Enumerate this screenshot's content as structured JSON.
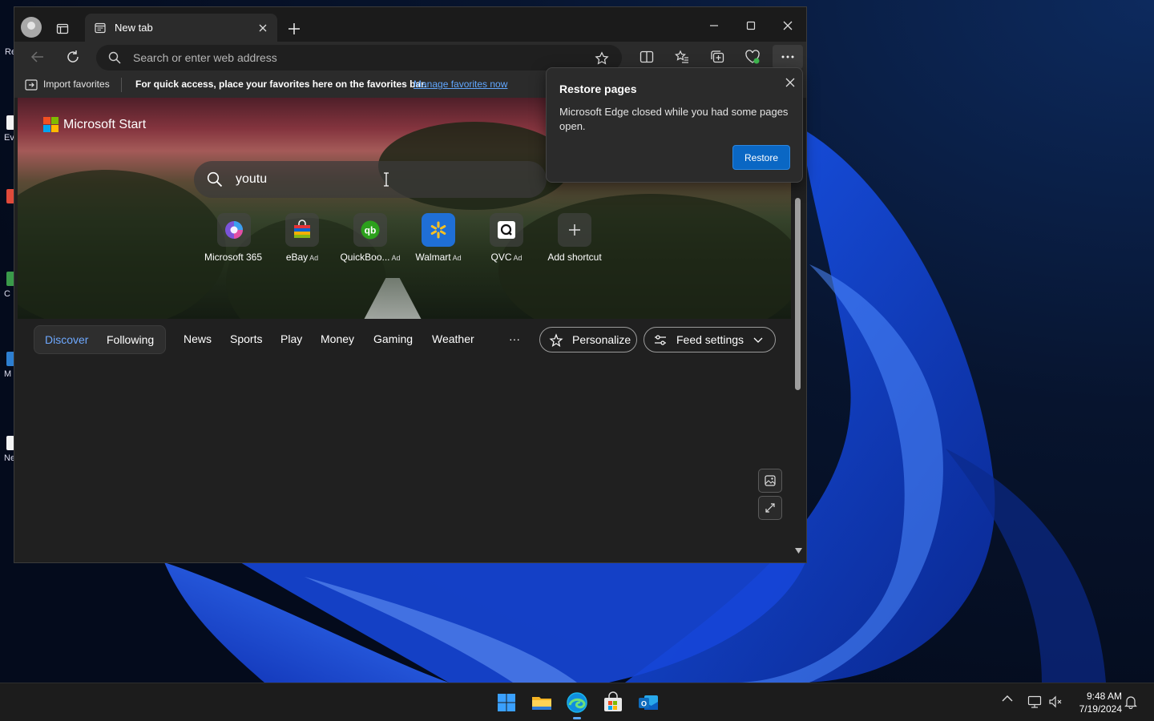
{
  "desktop": {
    "top_label": "Re",
    "icons": [
      {
        "label": "Ev",
        "color": "#f4f4f4"
      },
      {
        "label": "",
        "color": "#e04a3a"
      },
      {
        "label": "C",
        "color": "#3a9a4a"
      },
      {
        "label": "M",
        "color": "#2d7fd1"
      },
      {
        "label": "Ne",
        "color": "#f4f4f4"
      }
    ]
  },
  "browser": {
    "tab": {
      "title": "New tab"
    },
    "address": {
      "placeholder": "Search or enter web address"
    },
    "favorites_bar": {
      "import_label": "Import favorites",
      "message": "For quick access, place your favorites here on the favorites bar.",
      "link": "Manage favorites now"
    }
  },
  "start_page": {
    "brand": "Microsoft Start",
    "search_value": "youtu",
    "shortcuts": [
      {
        "label": "Microsoft 365",
        "ad": "",
        "icon": "microsoft-365-icon"
      },
      {
        "label": "eBay",
        "ad": "Ad",
        "icon": "ebay-icon"
      },
      {
        "label": "QuickBoo...",
        "ad": "Ad",
        "icon": "quickbooks-icon"
      },
      {
        "label": "Walmart",
        "ad": "Ad",
        "icon": "walmart-icon"
      },
      {
        "label": "QVC",
        "ad": "Ad",
        "icon": "qvc-icon"
      },
      {
        "label": "Add shortcut",
        "ad": "",
        "icon": "plus-icon"
      }
    ],
    "feed_tabs": {
      "discover": "Discover",
      "following": "Following"
    },
    "nav_items": [
      "News",
      "Sports",
      "Play",
      "Money",
      "Gaming",
      "Weather"
    ],
    "more": "···",
    "personalize": "Personalize",
    "feed_settings": "Feed settings"
  },
  "restore_popup": {
    "title": "Restore pages",
    "body": "Microsoft Edge closed while you had some pages open.",
    "button": "Restore"
  },
  "taskbar": {
    "time": "9:48 AM",
    "date": "7/19/2024",
    "apps": [
      "start-icon",
      "file-explorer-icon",
      "edge-icon",
      "microsoft-store-icon",
      "outlook-icon"
    ]
  },
  "colors": {
    "accent": "#0a67c4",
    "link": "#61a7ff",
    "discover_active": "#6ea8fe"
  }
}
